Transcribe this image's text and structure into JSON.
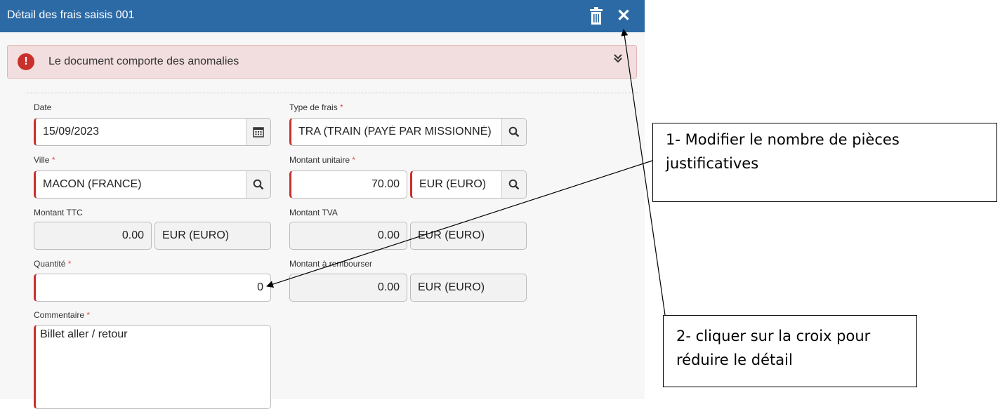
{
  "dialog": {
    "title": "Détail des frais saisis 001",
    "alert_text": "Le document comporte des anomalies",
    "accent": "#2c6aa6",
    "alert_color": "#c9302c"
  },
  "form": {
    "date_label": "Date",
    "date_value": "15/09/2023",
    "type_label": "Type de frais",
    "type_value": "TRA (TRAIN (PAYÉ PAR MISSIONNÉ)",
    "ville_label": "Ville",
    "ville_value": "MACON (FRANCE)",
    "montant_unitaire_label": "Montant unitaire",
    "montant_unitaire_value": "70.00",
    "montant_unitaire_currency": "EUR (EURO)",
    "montant_ttc_label": "Montant TTC",
    "montant_ttc_value": "0.00",
    "montant_ttc_currency": "EUR (EURO)",
    "montant_tva_label": "Montant TVA",
    "montant_tva_value": "0.00",
    "montant_tva_currency": "EUR (EURO)",
    "quantite_label": "Quantité",
    "quantite_value": "0",
    "montant_rembourser_label": "Montant à rembourser",
    "montant_rembourser_value": "0.00",
    "montant_rembourser_currency": "EUR (EURO)",
    "commentaire_label": "Commentaire",
    "commentaire_value": "Billet aller / retour",
    "required_mark": "*"
  },
  "annotations": {
    "callout1": "1- Modifier le nombre de pièces justificatives",
    "callout2": "2- cliquer sur la croix pour réduire le détail"
  },
  "icons": [
    "trash-icon",
    "close-icon",
    "alert-exclamation-icon",
    "double-chevron-down-icon",
    "calendar-icon",
    "search-icon"
  ]
}
